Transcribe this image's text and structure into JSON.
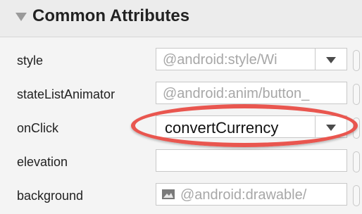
{
  "section": {
    "title": "Common Attributes"
  },
  "rows": [
    {
      "label": "style",
      "value": "@android:style/Wi"
    },
    {
      "label": "stateListAnimator",
      "value": "@android:anim/button_"
    },
    {
      "label": "onClick",
      "value": "convertCurrency"
    },
    {
      "label": "elevation",
      "value": ""
    },
    {
      "label": "background",
      "value": "@android:drawable/"
    }
  ],
  "colors": {
    "highlight": "#e9564f",
    "placeholder_text": "#a7a7a7"
  }
}
